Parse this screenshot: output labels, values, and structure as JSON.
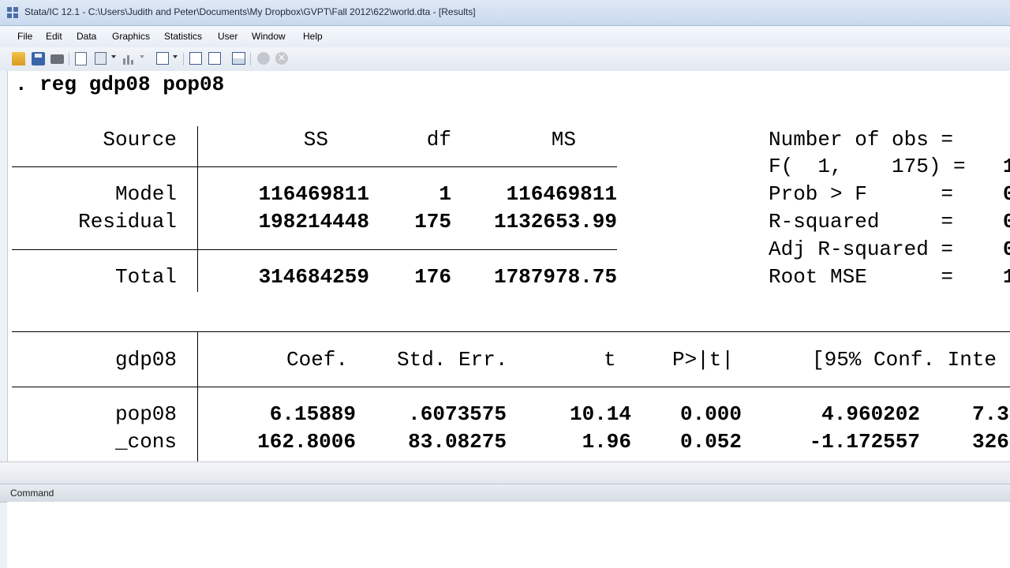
{
  "window": {
    "title": "Stata/IC 12.1 - C:\\Users\\Judith and Peter\\Documents\\My Dropbox\\GVPT\\Fall 2012\\622\\world.dta - [Results]"
  },
  "menu": [
    "File",
    "Edit",
    "Data",
    "Graphics",
    "Statistics",
    "User",
    "Window",
    "Help"
  ],
  "toolbar": {
    "icons": [
      "open-icon",
      "save-icon",
      "print-icon",
      "log-icon",
      "viewer-icon",
      "graph-icon",
      "dofile-editor-icon",
      "data-editor-icon",
      "data-browser-icon",
      "variables-manager-icon",
      "more-icon",
      "break-icon"
    ],
    "break_glyph": "×"
  },
  "results": {
    "command": ". reg gdp08 pop08",
    "anova": {
      "headers": [
        "Source",
        "SS",
        "df",
        "MS"
      ],
      "rows": [
        {
          "source": "Model",
          "ss": "116469811",
          "df": "1",
          "ms": "116469811"
        },
        {
          "source": "Residual",
          "ss": "198214448",
          "df": "175",
          "ms": "1132653.99"
        }
      ],
      "total": {
        "source": "Total",
        "ss": "314684259",
        "df": "176",
        "ms": "1787978.75"
      }
    },
    "stats": [
      {
        "label": "Number of obs =",
        "value": ""
      },
      {
        "label": "F(  1,    175) =",
        "value": "1"
      },
      {
        "label": "Prob > F      =",
        "value": "0"
      },
      {
        "label": "R-squared     =",
        "value": "0"
      },
      {
        "label": "Adj R-squared =",
        "value": "0"
      },
      {
        "label": "Root MSE      =",
        "value": "1"
      }
    ],
    "coef": {
      "depvar": "gdp08",
      "headers": [
        "Coef.",
        "Std. Err.",
        "t",
        "P>|t|",
        "[95% Conf. Inte"
      ],
      "rows": [
        {
          "name": "pop08",
          "coef": "6.15889",
          "se": ".6073575",
          "t": "10.14",
          "p": "0.000",
          "lo": "4.960202",
          "hi": "7.3"
        },
        {
          "name": "_cons",
          "coef": "162.8006",
          "se": "83.08275",
          "t": "1.96",
          "p": "0.052",
          "lo": "-1.172557",
          "hi": "326"
        }
      ]
    }
  },
  "command_pane": {
    "label": "Command",
    "value": ""
  }
}
